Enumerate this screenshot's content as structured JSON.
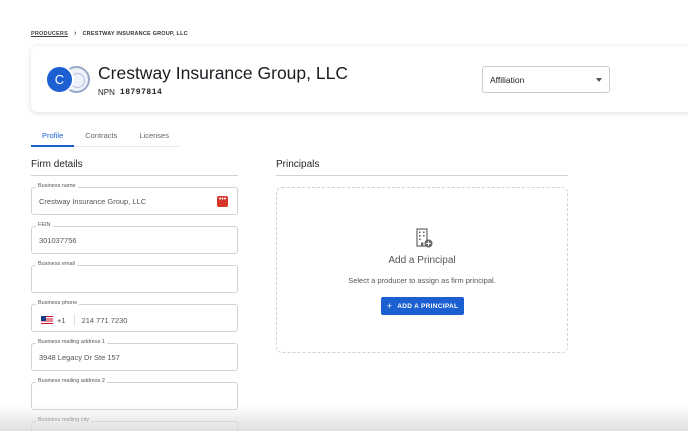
{
  "breadcrumb": {
    "parent": "PRODUCERS",
    "current": "CRESTWAY INSURANCE GROUP, LLC"
  },
  "header": {
    "avatar_letter": "C",
    "firm_name": "Crestway Insurance Group, LLC",
    "npn_label": "NPN",
    "npn_value": "18797814",
    "affiliation_label": "Affiliation"
  },
  "tabs": [
    {
      "label": "Profile",
      "active": true
    },
    {
      "label": "Contracts",
      "active": false
    },
    {
      "label": "Licenses",
      "active": false
    }
  ],
  "firm_details": {
    "title": "Firm details",
    "fields": [
      {
        "label": "Business name",
        "value": "Crestway Insurance Group, LLC"
      },
      {
        "label": "FEIN",
        "value": "301037756"
      },
      {
        "label": "Business email",
        "value": ""
      },
      {
        "label": "Business phone",
        "country_code": "+1",
        "value": "214 771 7230"
      },
      {
        "label": "Business mailing address 1",
        "value": "3948 Legacy Dr Ste 157"
      },
      {
        "label": "Business mailing address 2",
        "value": ""
      },
      {
        "label": "Business mailing city",
        "value": ""
      }
    ],
    "badge_glyph": "•••"
  },
  "principals": {
    "title": "Principals",
    "empty_title": "Add a Principal",
    "empty_description": "Select a producer to assign as firm principal.",
    "button_label": "ADD A PRINCIPAL",
    "button_glyph": "+"
  },
  "colors": {
    "accent": "#1c5fd1",
    "badge": "#d9362b"
  }
}
